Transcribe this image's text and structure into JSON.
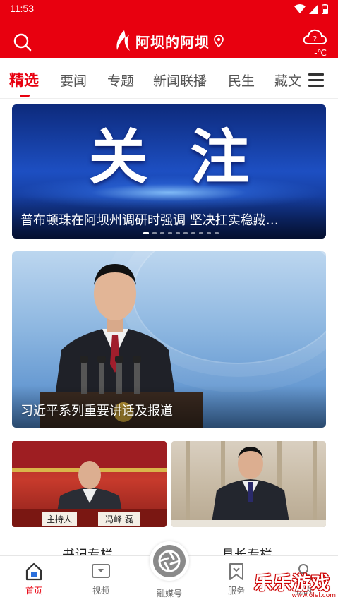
{
  "status_bar": {
    "time": "11:53"
  },
  "header": {
    "logo_text": "阿坝的阿坝",
    "temperature": "-℃",
    "brand_color": "#e8000f"
  },
  "tabs": [
    {
      "label": "精选",
      "active": true
    },
    {
      "label": "要闻",
      "active": false
    },
    {
      "label": "专题",
      "active": false
    },
    {
      "label": "新闻联播",
      "active": false
    },
    {
      "label": "民生",
      "active": false
    },
    {
      "label": "藏文",
      "active": false
    }
  ],
  "banner": {
    "big_text": "关注",
    "caption": "普布顿珠在阿坝州调研时强调 坚决扛实稳藏…",
    "dot_count": 10,
    "active_dot": 0
  },
  "feature": {
    "caption": "习近平系列重要讲话及报道"
  },
  "columns": {
    "left_label": "书记专栏",
    "right_label": "县长专栏",
    "left_nameplate_1": "主持人",
    "left_nameplate_2": "冯峰 磊"
  },
  "bottom_nav": {
    "home": "首页",
    "video": "视频",
    "center": "融媒号",
    "service": "服务",
    "mine": "我的"
  },
  "watermark": {
    "text": "乐乐游戏",
    "url": "www.6lel.com"
  },
  "icons": {
    "search": "search-icon",
    "weather": "cloud-question-icon",
    "menu": "hamburger-icon",
    "location": "location-pin-icon"
  }
}
